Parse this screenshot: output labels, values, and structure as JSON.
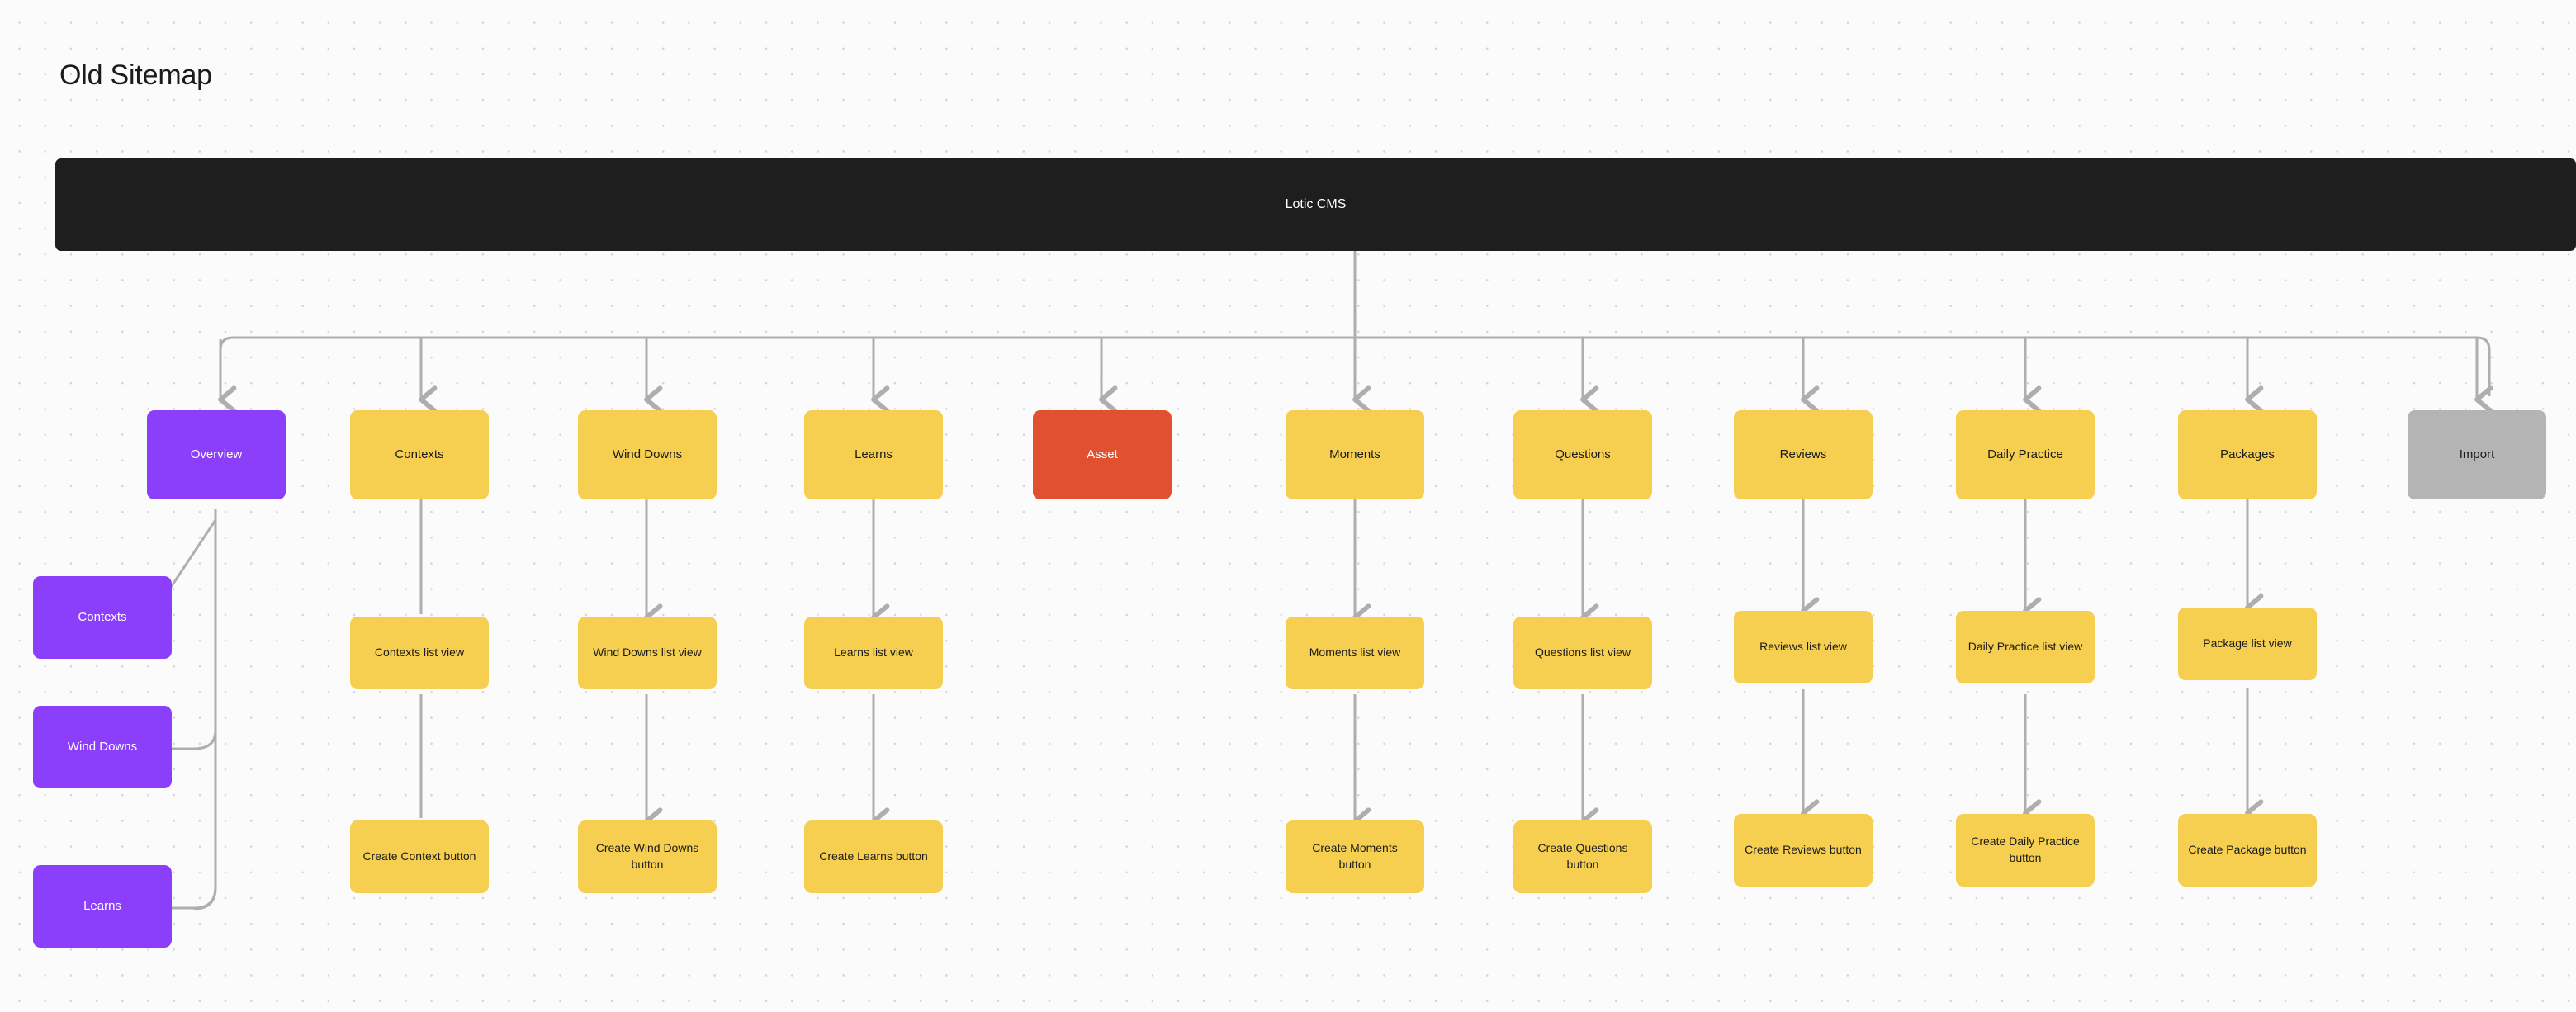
{
  "page": {
    "title": "Old Sitemap",
    "background_color": "#fbfbfb",
    "grid_dot_color": "#d4d4d8"
  },
  "colors": {
    "root": "#1e1e1e",
    "yellow": "#f6cf50",
    "purple": "#8b3ffb",
    "red": "#e1502f",
    "gray": "#b4b4b4",
    "connector": "#aeaeae",
    "text_dark": "#1b1b1b",
    "text_light": "#ffffff"
  },
  "diagram": {
    "type": "sitemap",
    "root": {
      "label": "Lotic CMS",
      "color": "#1e1e1e",
      "text_color": "#ffffff"
    },
    "top_level_nodes": [
      {
        "label": "Overview",
        "color": "#8b3ffb",
        "text_color": "#ffffff"
      },
      {
        "label": "Contexts",
        "color": "#f6cf50",
        "text_color": "#1b1b1b"
      },
      {
        "label": "Wind Downs",
        "color": "#f6cf50",
        "text_color": "#1b1b1b"
      },
      {
        "label": "Learns",
        "color": "#f6cf50",
        "text_color": "#1b1b1b"
      },
      {
        "label": "Asset",
        "color": "#e1502f",
        "text_color": "#ffffff"
      },
      {
        "label": "Moments",
        "color": "#f6cf50",
        "text_color": "#1b1b1b"
      },
      {
        "label": "Questions",
        "color": "#f6cf50",
        "text_color": "#1b1b1b"
      },
      {
        "label": "Reviews",
        "color": "#f6cf50",
        "text_color": "#1b1b1b"
      },
      {
        "label": "Daily Practice",
        "color": "#f6cf50",
        "text_color": "#1b1b1b"
      },
      {
        "label": "Packages",
        "color": "#f6cf50",
        "text_color": "#1b1b1b"
      },
      {
        "label": "Import",
        "color": "#b4b4b4",
        "text_color": "#1b1b1b"
      }
    ],
    "overview_children": [
      {
        "label": "Contexts",
        "color": "#8b3ffb",
        "text_color": "#ffffff"
      },
      {
        "label": "Wind Downs",
        "color": "#8b3ffb",
        "text_color": "#ffffff"
      },
      {
        "label": "Learns",
        "color": "#8b3ffb",
        "text_color": "#ffffff"
      }
    ],
    "list_view_nodes": [
      {
        "label": "Contexts list view",
        "color": "#f6cf50"
      },
      {
        "label": "Wind Downs list view",
        "color": "#f6cf50"
      },
      {
        "label": "Learns list view",
        "color": "#f6cf50"
      },
      {
        "label": "Moments list view",
        "color": "#f6cf50"
      },
      {
        "label": "Questions list view",
        "color": "#f6cf50"
      },
      {
        "label": "Reviews list view",
        "color": "#f6cf50"
      },
      {
        "label": "Daily Practice list view",
        "color": "#f6cf50"
      },
      {
        "label": "Package list view",
        "color": "#f6cf50"
      }
    ],
    "create_button_nodes": [
      {
        "label": "Create Context button",
        "color": "#f6cf50"
      },
      {
        "label": "Create Wind Downs button",
        "color": "#f6cf50"
      },
      {
        "label": "Create Learns button",
        "color": "#f6cf50"
      },
      {
        "label": "Create Moments button",
        "color": "#f6cf50"
      },
      {
        "label": "Create Questions button",
        "color": "#f6cf50"
      },
      {
        "label": "Create Reviews button",
        "color": "#f6cf50"
      },
      {
        "label": "Create Daily Practice button",
        "color": "#f6cf50"
      },
      {
        "label": "Create Package button",
        "color": "#f6cf50"
      }
    ]
  }
}
